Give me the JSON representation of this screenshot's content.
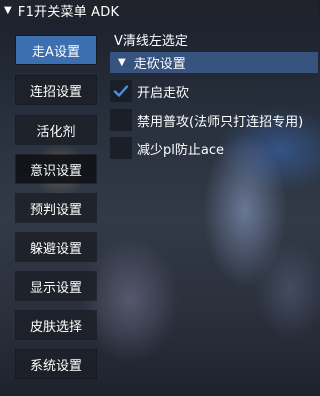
{
  "window": {
    "title": "F1开关菜单 ADK",
    "collapse_glyph": "▼"
  },
  "sidebar": {
    "items": [
      {
        "label": "走A设置",
        "state": "active"
      },
      {
        "label": "连招设置",
        "state": "normal"
      },
      {
        "label": "活化剂",
        "state": "normal"
      },
      {
        "label": "意识设置",
        "state": "selected"
      },
      {
        "label": "预判设置",
        "state": "normal"
      },
      {
        "label": "躲避设置",
        "state": "normal"
      },
      {
        "label": "显示设置",
        "state": "normal"
      },
      {
        "label": "皮肤选择",
        "state": "normal"
      },
      {
        "label": "系统设置",
        "state": "normal"
      }
    ]
  },
  "main": {
    "hint": "V清线左选定",
    "section": {
      "glyph": "▼",
      "title": "走砍设置",
      "options": [
        {
          "label": "开启走砍",
          "checked": true
        },
        {
          "label": "禁用普攻(法师只打连招专用)",
          "checked": false
        },
        {
          "label": "减少pl防止ace",
          "checked": false
        }
      ]
    }
  },
  "colors": {
    "accent": "#3c6fb0",
    "header_bg": "#3a5c8c",
    "checkmark": "#4a8fe0",
    "title_bg": "#20232b"
  }
}
